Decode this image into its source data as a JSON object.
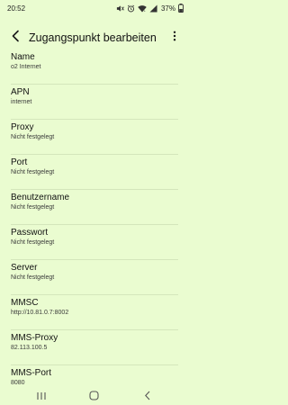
{
  "status_bar": {
    "time": "20:52",
    "battery": "37%",
    "icons": [
      "mute-icon",
      "alarm-icon",
      "wifi-icon",
      "signal-icon",
      "battery-icon"
    ]
  },
  "header": {
    "title": "Zugangspunkt bearbeiten",
    "back_icon": "back-arrow-icon",
    "more_icon": "more-vert-icon"
  },
  "fields": [
    {
      "label": "Name",
      "value": "o2 Internet"
    },
    {
      "label": "APN",
      "value": "internet"
    },
    {
      "label": "Proxy",
      "value": "Nicht festgelegt"
    },
    {
      "label": "Port",
      "value": "Nicht festgelegt"
    },
    {
      "label": "Benutzername",
      "value": "Nicht festgelegt"
    },
    {
      "label": "Passwort",
      "value": "Nicht festgelegt"
    },
    {
      "label": "Server",
      "value": "Nicht festgelegt"
    },
    {
      "label": "MMSC",
      "value": "http://10.81.0.7:8002"
    },
    {
      "label": "MMS-Proxy",
      "value": "82.113.100.5"
    },
    {
      "label": "MMS-Port",
      "value": "8080"
    }
  ],
  "nav_bar": {
    "icons": [
      "recents-icon",
      "home-icon",
      "back-icon"
    ]
  },
  "colors": {
    "background": "#eafcd0",
    "divider": "#d4e6bb",
    "text": "#121212"
  }
}
